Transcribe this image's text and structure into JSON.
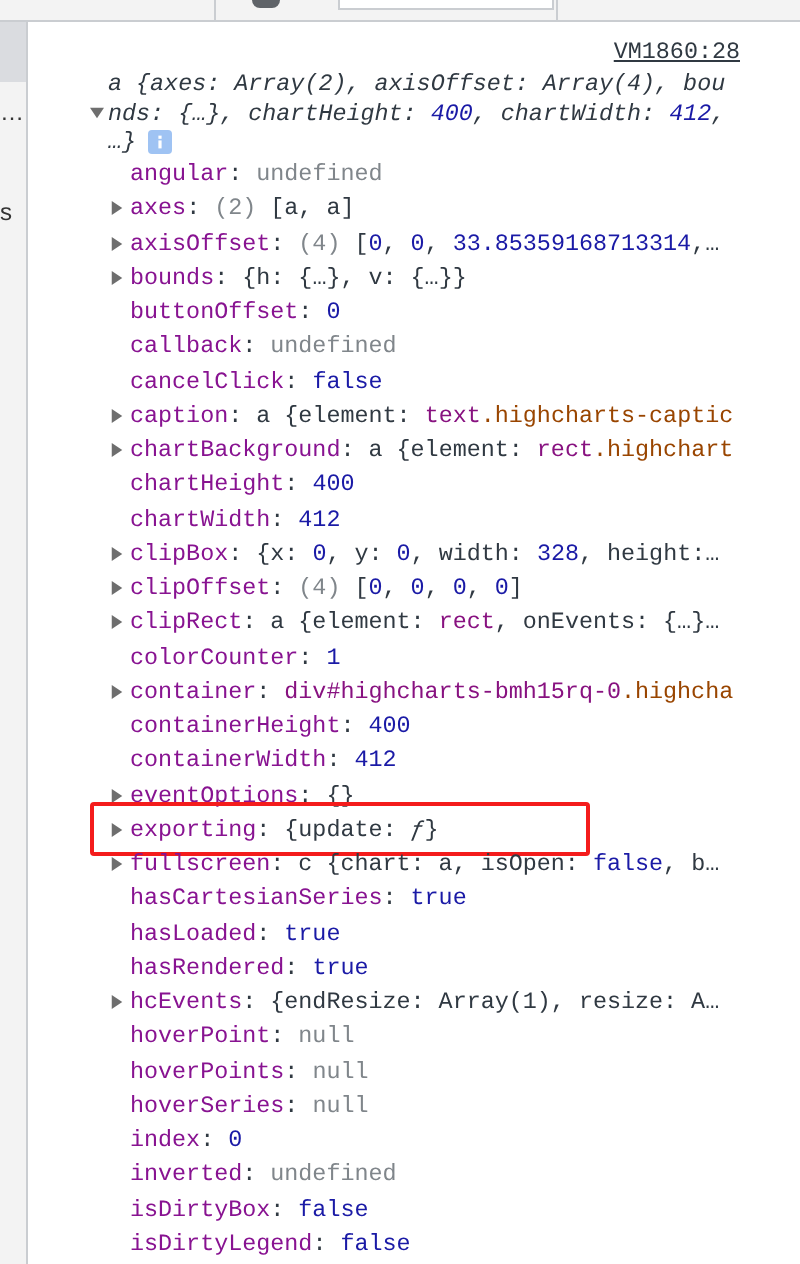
{
  "toolbar": {
    "filter_field": {
      "kind": "field"
    }
  },
  "sidebar": {
    "items": [
      {
        "selected": true
      },
      {
        "label": "…",
        "selected": false
      },
      {
        "label": "s",
        "selected": false
      }
    ]
  },
  "console": {
    "source_link": "VM1860:28",
    "separator": ": ",
    "summary": {
      "expanded": true,
      "segments": [
        {
          "kind": "plain",
          "text": "a {axes: Array(2), axisOffset: Array(4), bounds: {…}, chartHeight: "
        },
        {
          "kind": "number",
          "text": "400"
        },
        {
          "kind": "plain",
          "text": ", chartWidth: "
        },
        {
          "kind": "number",
          "text": "412"
        },
        {
          "kind": "plain",
          "text": ", …}"
        }
      ]
    },
    "rows": [
      {
        "key": "angular",
        "expandable": false,
        "highlighted": false,
        "value": [
          {
            "kind": "nullish",
            "text": "undefined"
          }
        ]
      },
      {
        "key": "axes",
        "expandable": true,
        "highlighted": false,
        "value": [
          {
            "kind": "count",
            "text": "(2)"
          },
          {
            "kind": "plain",
            "text": " [a, a]"
          }
        ]
      },
      {
        "key": "axisOffset",
        "expandable": true,
        "highlighted": false,
        "value": [
          {
            "kind": "count",
            "text": "(4)"
          },
          {
            "kind": "plain",
            "text": " ["
          },
          {
            "kind": "number",
            "text": "0"
          },
          {
            "kind": "plain",
            "text": ", "
          },
          {
            "kind": "number",
            "text": "0"
          },
          {
            "kind": "plain",
            "text": ", "
          },
          {
            "kind": "number",
            "text": "33.85359168713314"
          },
          {
            "kind": "plain",
            "text": ",…"
          }
        ]
      },
      {
        "key": "bounds",
        "expandable": true,
        "highlighted": false,
        "value": [
          {
            "kind": "plain",
            "text": "{h: {…}, v: {…}}"
          }
        ]
      },
      {
        "key": "buttonOffset",
        "expandable": false,
        "highlighted": false,
        "value": [
          {
            "kind": "number",
            "text": "0"
          }
        ]
      },
      {
        "key": "callback",
        "expandable": false,
        "highlighted": false,
        "value": [
          {
            "kind": "nullish",
            "text": "undefined"
          }
        ]
      },
      {
        "key": "cancelClick",
        "expandable": false,
        "highlighted": false,
        "value": [
          {
            "kind": "number",
            "text": "false"
          }
        ]
      },
      {
        "key": "caption",
        "expandable": true,
        "highlighted": false,
        "value": [
          {
            "kind": "plain",
            "text": "a {element: "
          },
          {
            "kind": "tag",
            "text": "text"
          },
          {
            "kind": "cls",
            "text": ".highcharts-captic"
          }
        ]
      },
      {
        "key": "chartBackground",
        "expandable": true,
        "highlighted": false,
        "value": [
          {
            "kind": "plain",
            "text": "a {element: "
          },
          {
            "kind": "tag",
            "text": "rect"
          },
          {
            "kind": "cls",
            "text": ".highchart"
          }
        ]
      },
      {
        "key": "chartHeight",
        "expandable": false,
        "highlighted": false,
        "value": [
          {
            "kind": "number",
            "text": "400"
          }
        ]
      },
      {
        "key": "chartWidth",
        "expandable": false,
        "highlighted": false,
        "value": [
          {
            "kind": "number",
            "text": "412"
          }
        ]
      },
      {
        "key": "clipBox",
        "expandable": true,
        "highlighted": false,
        "value": [
          {
            "kind": "plain",
            "text": "{x: "
          },
          {
            "kind": "number",
            "text": "0"
          },
          {
            "kind": "plain",
            "text": ", y: "
          },
          {
            "kind": "number",
            "text": "0"
          },
          {
            "kind": "plain",
            "text": ", width: "
          },
          {
            "kind": "number",
            "text": "328"
          },
          {
            "kind": "plain",
            "text": ", height:…"
          }
        ]
      },
      {
        "key": "clipOffset",
        "expandable": true,
        "highlighted": false,
        "value": [
          {
            "kind": "count",
            "text": "(4)"
          },
          {
            "kind": "plain",
            "text": " ["
          },
          {
            "kind": "number",
            "text": "0"
          },
          {
            "kind": "plain",
            "text": ", "
          },
          {
            "kind": "number",
            "text": "0"
          },
          {
            "kind": "plain",
            "text": ", "
          },
          {
            "kind": "number",
            "text": "0"
          },
          {
            "kind": "plain",
            "text": ", "
          },
          {
            "kind": "number",
            "text": "0"
          },
          {
            "kind": "plain",
            "text": "]"
          }
        ]
      },
      {
        "key": "clipRect",
        "expandable": true,
        "highlighted": false,
        "value": [
          {
            "kind": "plain",
            "text": "a {element: "
          },
          {
            "kind": "tag",
            "text": "rect"
          },
          {
            "kind": "plain",
            "text": ", onEvents: {…}…"
          }
        ]
      },
      {
        "key": "colorCounter",
        "expandable": false,
        "highlighted": false,
        "value": [
          {
            "kind": "number",
            "text": "1"
          }
        ]
      },
      {
        "key": "container",
        "expandable": true,
        "highlighted": false,
        "value": [
          {
            "kind": "tag",
            "text": "div#highcharts-bmh15rq-0"
          },
          {
            "kind": "cls",
            "text": ".highcha"
          }
        ]
      },
      {
        "key": "containerHeight",
        "expandable": false,
        "highlighted": false,
        "value": [
          {
            "kind": "number",
            "text": "400"
          }
        ]
      },
      {
        "key": "containerWidth",
        "expandable": false,
        "highlighted": false,
        "value": [
          {
            "kind": "number",
            "text": "412"
          }
        ]
      },
      {
        "key": "eventOptions",
        "expandable": true,
        "highlighted": false,
        "value": [
          {
            "kind": "plain",
            "text": "{}"
          }
        ]
      },
      {
        "key": "exporting",
        "expandable": true,
        "highlighted": true,
        "value": [
          {
            "kind": "plain",
            "text": "{update: "
          },
          {
            "kind": "fn",
            "text": "ƒ"
          },
          {
            "kind": "plain",
            "text": "}"
          }
        ]
      },
      {
        "key": "fullscreen",
        "expandable": true,
        "highlighted": false,
        "value": [
          {
            "kind": "plain",
            "text": "c {chart: a, isOpen: "
          },
          {
            "kind": "number",
            "text": "false"
          },
          {
            "kind": "plain",
            "text": ", b…"
          }
        ]
      },
      {
        "key": "hasCartesianSeries",
        "expandable": false,
        "highlighted": false,
        "value": [
          {
            "kind": "number",
            "text": "true"
          }
        ]
      },
      {
        "key": "hasLoaded",
        "expandable": false,
        "highlighted": false,
        "value": [
          {
            "kind": "number",
            "text": "true"
          }
        ]
      },
      {
        "key": "hasRendered",
        "expandable": false,
        "highlighted": false,
        "value": [
          {
            "kind": "number",
            "text": "true"
          }
        ]
      },
      {
        "key": "hcEvents",
        "expandable": true,
        "highlighted": false,
        "value": [
          {
            "kind": "plain",
            "text": "{endResize: Array(1), resize: A…"
          }
        ]
      },
      {
        "key": "hoverPoint",
        "expandable": false,
        "highlighted": false,
        "value": [
          {
            "kind": "nullish",
            "text": "null"
          }
        ]
      },
      {
        "key": "hoverPoints",
        "expandable": false,
        "highlighted": false,
        "value": [
          {
            "kind": "nullish",
            "text": "null"
          }
        ]
      },
      {
        "key": "hoverSeries",
        "expandable": false,
        "highlighted": false,
        "value": [
          {
            "kind": "nullish",
            "text": "null"
          }
        ]
      },
      {
        "key": "index",
        "expandable": false,
        "highlighted": false,
        "value": [
          {
            "kind": "number",
            "text": "0"
          }
        ]
      },
      {
        "key": "inverted",
        "expandable": false,
        "highlighted": false,
        "value": [
          {
            "kind": "nullish",
            "text": "undefined"
          }
        ]
      },
      {
        "key": "isDirtyBox",
        "expandable": false,
        "highlighted": false,
        "value": [
          {
            "kind": "number",
            "text": "false"
          }
        ]
      },
      {
        "key": "isDirtyLegend",
        "expandable": false,
        "highlighted": false,
        "value": [
          {
            "kind": "number",
            "text": "false"
          }
        ]
      }
    ]
  }
}
